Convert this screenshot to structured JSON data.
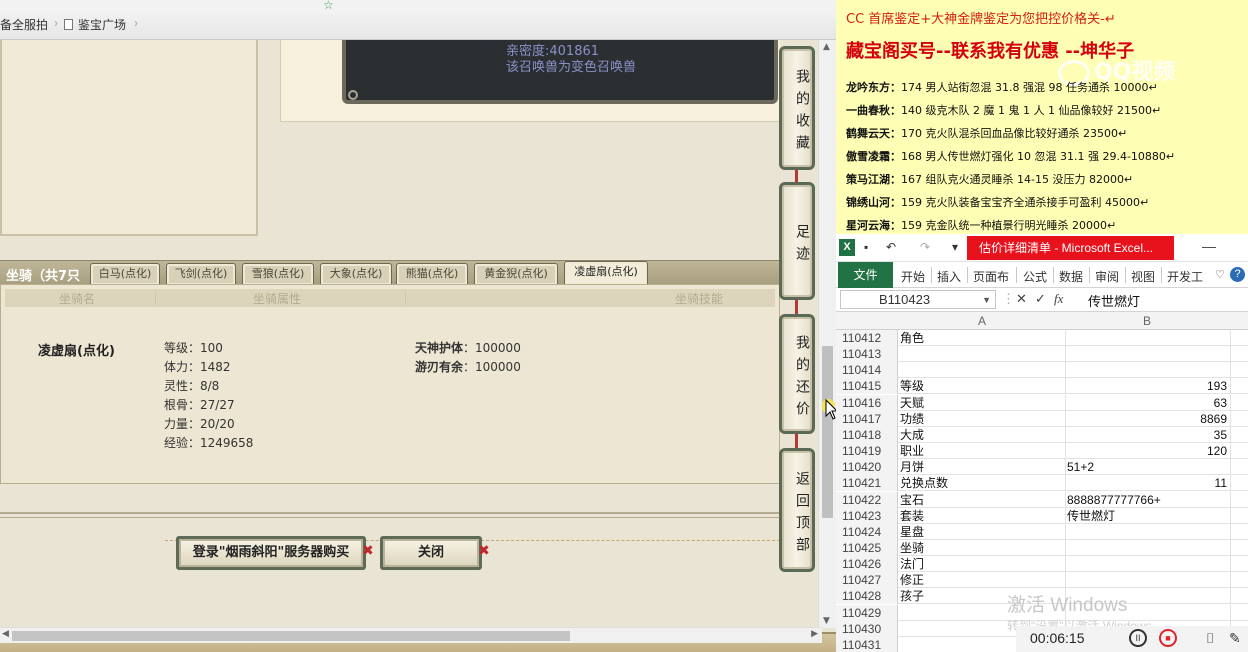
{
  "browser": {
    "bookmarks": [
      {
        "label": "备全服拍"
      },
      {
        "label": "鉴宝广场"
      }
    ],
    "chevron": "›"
  },
  "pet_info": {
    "line1": "亲密度:401861",
    "line2": "该召唤兽为变色召唤兽"
  },
  "mount": {
    "title": "坐骑（共7只",
    "tabs": [
      "白马(点化)",
      "飞剑(点化)",
      "雪狼(点化)",
      "大象(点化)",
      "熊猫(点化)",
      "黄金猊(点化)",
      "凌虚扇(点化)"
    ],
    "active_tab": 6,
    "headers": {
      "name": "坐骑名",
      "attributes": "坐骑属性",
      "skills": "坐骑技能"
    },
    "name": "凌虚扇(点化)",
    "attributes": [
      "等级：100",
      "体力：1482",
      "灵性：8/8",
      "根骨：27/27",
      "力量：20/20",
      "经验：1249658"
    ],
    "skills": [
      {
        "name": "天神护体",
        "value": "：100000"
      },
      {
        "name": "游刃有余",
        "value": "：100000"
      }
    ]
  },
  "actions": {
    "login_buy": "登录\"烟雨斜阳\"服务器购买",
    "close": "关闭",
    "x_mark": "✖"
  },
  "side_nav": [
    {
      "label": "我的收藏"
    },
    {
      "label": "足迹"
    },
    {
      "label": "我的还价"
    },
    {
      "label": "返回顶部"
    }
  ],
  "doc": {
    "top_line": "CC 首席鉴定+大神金牌鉴定为您把控价格关-↵",
    "headline": "藏宝阁买号--联系我有优惠 --坤华子",
    "watermark": "QQ视频",
    "lines": [
      {
        "name": "龙吟东方：",
        "text": "174 男人站街忽混 31.8 强混 98 任务通杀 10000↵"
      },
      {
        "name": "一曲春秋：",
        "text": "140 级克木队 2 魔 1 鬼 1 人 1 仙品像较好 21500↵"
      },
      {
        "name": "鹤舞云天：",
        "text": "170 克火队混杀回血品像比较好通杀 23500↵"
      },
      {
        "name": "傲雪凌霜：",
        "text": "168 男人传世燃灯强化 10 忽混 31.1 强 29.4-10880↵"
      },
      {
        "name": "策马江湖：",
        "text": "167 组队克火通灵睡杀 14-15 没压力 82000↵"
      },
      {
        "name": "锦绣山河：",
        "text": "159 克火队装备宝宝齐全通杀接手可盈利 45000↵"
      },
      {
        "name": "星河云海：",
        "text": "159 克金队统一种植景行明光睡杀 20000↵"
      }
    ]
  },
  "excel": {
    "logo": "X",
    "title": "估价详细清单 - Microsoft Excel...",
    "minimize": "—",
    "tabs": [
      "文件",
      "开始",
      "插入",
      "页面布",
      "公式",
      "数据",
      "审阅",
      "视图",
      "开发工"
    ],
    "help": "?",
    "name_box": "B110423",
    "formula": "传世燃灯",
    "fx": "fx",
    "col_a": "A",
    "col_b": "B",
    "rows": [
      {
        "n": "110412",
        "a": "角色",
        "b": "",
        "num": false
      },
      {
        "n": "110413",
        "a": "",
        "b": "",
        "num": false
      },
      {
        "n": "110414",
        "a": "",
        "b": "",
        "num": false
      },
      {
        "n": "110415",
        "a": "等级",
        "b": "193",
        "num": true
      },
      {
        "n": "110416",
        "a": "天赋",
        "b": "63",
        "num": true
      },
      {
        "n": "110417",
        "a": "功绩",
        "b": "8869",
        "num": true
      },
      {
        "n": "110418",
        "a": "大成",
        "b": "35",
        "num": true
      },
      {
        "n": "110419",
        "a": "职业",
        "b": "120",
        "num": true
      },
      {
        "n": "110420",
        "a": "月饼",
        "b": "51+2",
        "num": false
      },
      {
        "n": "110421",
        "a": "兑换点数",
        "b": "11",
        "num": true
      },
      {
        "n": "110422",
        "a": "宝石",
        "b": "8888877777766+",
        "num": false
      },
      {
        "n": "110423",
        "a": "套装",
        "b": "传世燃灯",
        "num": false
      },
      {
        "n": "110424",
        "a": "星盘",
        "b": "",
        "num": false
      },
      {
        "n": "110425",
        "a": "坐骑",
        "b": "",
        "num": false
      },
      {
        "n": "110426",
        "a": "法门",
        "b": "",
        "num": false
      },
      {
        "n": "110427",
        "a": "修正",
        "b": "",
        "num": false
      },
      {
        "n": "110428",
        "a": "孩子",
        "b": "",
        "num": false
      },
      {
        "n": "110429",
        "a": "",
        "b": "",
        "num": false
      },
      {
        "n": "110430",
        "a": "",
        "b": "",
        "num": false
      },
      {
        "n": "110431",
        "a": "",
        "b": "",
        "num": false
      }
    ],
    "activate": "激活 Windows",
    "activate_sub": "转到\"设置\"以激活 Windows。"
  },
  "recorder": {
    "time": "00:06:15",
    "pause": "II",
    "stop": "■",
    "camera": "⌷",
    "pen": "✎"
  },
  "colors": {
    "doc_bg": "#fefeb4",
    "headline_red": "#d4000e",
    "excel_green": "#217346",
    "excel_title_red": "#e8121d"
  }
}
